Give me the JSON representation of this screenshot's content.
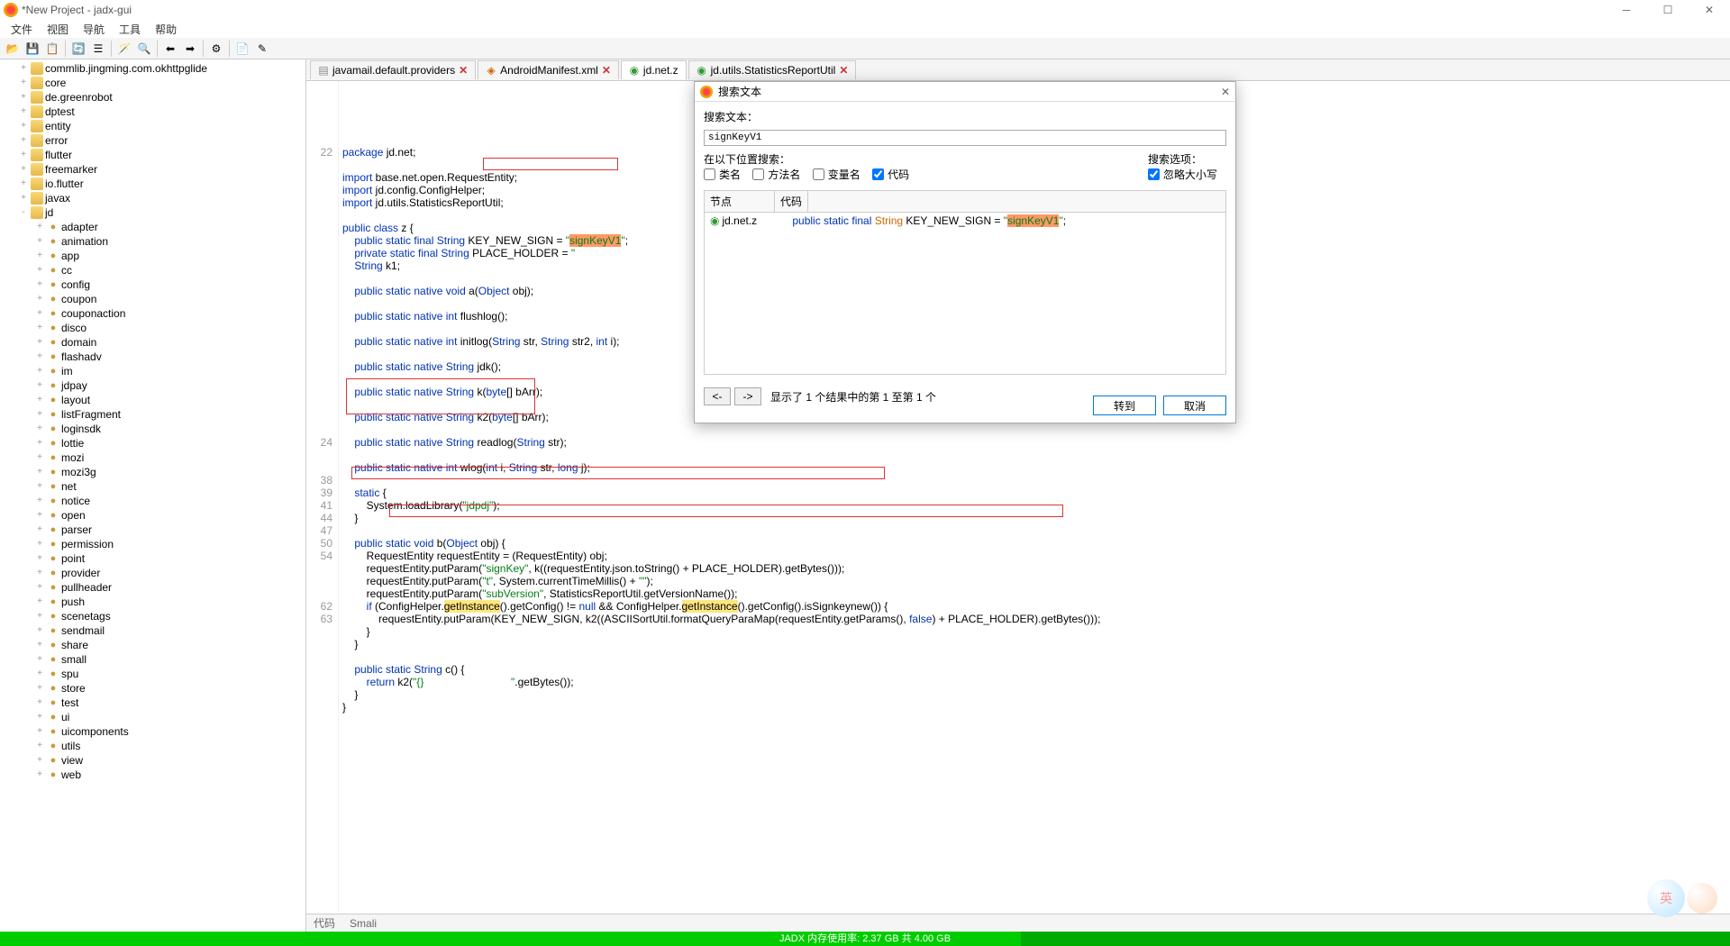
{
  "window": {
    "title": "*New Project - jadx-gui"
  },
  "menu": [
    "文件",
    "视图",
    "导航",
    "工具",
    "帮助"
  ],
  "tree": [
    {
      "l": 0,
      "t": "+",
      "n": "commlib.jingming.com.okhttpglide",
      "ico": "folder"
    },
    {
      "l": 0,
      "t": "+",
      "n": "core",
      "ico": "folder"
    },
    {
      "l": 0,
      "t": "+",
      "n": "de.greenrobot",
      "ico": "folder"
    },
    {
      "l": 0,
      "t": "+",
      "n": "dptest",
      "ico": "folder"
    },
    {
      "l": 0,
      "t": "+",
      "n": "entity",
      "ico": "folder"
    },
    {
      "l": 0,
      "t": "+",
      "n": "error",
      "ico": "folder"
    },
    {
      "l": 0,
      "t": "+",
      "n": "flutter",
      "ico": "folder"
    },
    {
      "l": 0,
      "t": "+",
      "n": "freemarker",
      "ico": "folder"
    },
    {
      "l": 0,
      "t": "+",
      "n": "io.flutter",
      "ico": "folder"
    },
    {
      "l": 0,
      "t": "+",
      "n": "javax",
      "ico": "folder"
    },
    {
      "l": 0,
      "t": "-",
      "n": "jd",
      "ico": "folder"
    },
    {
      "l": 1,
      "t": "+",
      "n": "adapter",
      "ico": "pkg"
    },
    {
      "l": 1,
      "t": "+",
      "n": "animation",
      "ico": "pkg"
    },
    {
      "l": 1,
      "t": "+",
      "n": "app",
      "ico": "pkg"
    },
    {
      "l": 1,
      "t": "+",
      "n": "cc",
      "ico": "pkg"
    },
    {
      "l": 1,
      "t": "+",
      "n": "config",
      "ico": "pkg"
    },
    {
      "l": 1,
      "t": "+",
      "n": "coupon",
      "ico": "pkg"
    },
    {
      "l": 1,
      "t": "+",
      "n": "couponaction",
      "ico": "pkg"
    },
    {
      "l": 1,
      "t": "+",
      "n": "disco",
      "ico": "pkg"
    },
    {
      "l": 1,
      "t": "+",
      "n": "domain",
      "ico": "pkg"
    },
    {
      "l": 1,
      "t": "+",
      "n": "flashadv",
      "ico": "pkg"
    },
    {
      "l": 1,
      "t": "+",
      "n": "im",
      "ico": "pkg"
    },
    {
      "l": 1,
      "t": "+",
      "n": "jdpay",
      "ico": "pkg"
    },
    {
      "l": 1,
      "t": "+",
      "n": "layout",
      "ico": "pkg"
    },
    {
      "l": 1,
      "t": "+",
      "n": "listFragment",
      "ico": "pkg"
    },
    {
      "l": 1,
      "t": "+",
      "n": "loginsdk",
      "ico": "pkg"
    },
    {
      "l": 1,
      "t": "+",
      "n": "lottie",
      "ico": "pkg"
    },
    {
      "l": 1,
      "t": "+",
      "n": "mozi",
      "ico": "pkg"
    },
    {
      "l": 1,
      "t": "+",
      "n": "mozi3g",
      "ico": "pkg"
    },
    {
      "l": 1,
      "t": "+",
      "n": "net",
      "ico": "pkg"
    },
    {
      "l": 1,
      "t": "+",
      "n": "notice",
      "ico": "pkg"
    },
    {
      "l": 1,
      "t": "+",
      "n": "open",
      "ico": "pkg"
    },
    {
      "l": 1,
      "t": "+",
      "n": "parser",
      "ico": "pkg"
    },
    {
      "l": 1,
      "t": "+",
      "n": "permission",
      "ico": "pkg"
    },
    {
      "l": 1,
      "t": "+",
      "n": "point",
      "ico": "pkg"
    },
    {
      "l": 1,
      "t": "+",
      "n": "provider",
      "ico": "pkg"
    },
    {
      "l": 1,
      "t": "+",
      "n": "pullheader",
      "ico": "pkg"
    },
    {
      "l": 1,
      "t": "+",
      "n": "push",
      "ico": "pkg"
    },
    {
      "l": 1,
      "t": "+",
      "n": "scenetags",
      "ico": "pkg"
    },
    {
      "l": 1,
      "t": "+",
      "n": "sendmail",
      "ico": "pkg"
    },
    {
      "l": 1,
      "t": "+",
      "n": "share",
      "ico": "pkg"
    },
    {
      "l": 1,
      "t": "+",
      "n": "small",
      "ico": "pkg"
    },
    {
      "l": 1,
      "t": "+",
      "n": "spu",
      "ico": "pkg"
    },
    {
      "l": 1,
      "t": "+",
      "n": "store",
      "ico": "pkg"
    },
    {
      "l": 1,
      "t": "+",
      "n": "test",
      "ico": "pkg"
    },
    {
      "l": 1,
      "t": "+",
      "n": "ui",
      "ico": "pkg"
    },
    {
      "l": 1,
      "t": "+",
      "n": "uicomponents",
      "ico": "pkg"
    },
    {
      "l": 1,
      "t": "+",
      "n": "utils",
      "ico": "pkg"
    },
    {
      "l": 1,
      "t": "+",
      "n": "view",
      "ico": "pkg"
    },
    {
      "l": 1,
      "t": "+",
      "n": "web",
      "ico": "pkg"
    }
  ],
  "tabs": [
    {
      "label": "javamail.default.providers",
      "icon": "file",
      "active": false,
      "close": true
    },
    {
      "label": "AndroidManifest.xml",
      "icon": "xml",
      "active": false,
      "close": true
    },
    {
      "label": "jd.net.z",
      "icon": "class",
      "active": true,
      "close": false
    },
    {
      "label": "jd.utils.StatisticsReportUtil",
      "icon": "class",
      "active": false,
      "close": true
    }
  ],
  "gutter": [
    "",
    "",
    "",
    "",
    "",
    "22",
    "",
    "",
    "",
    "",
    "",
    "",
    "",
    "",
    "",
    "",
    "",
    "",
    "",
    "",
    "",
    "",
    "",
    "",
    "",
    "",
    "",
    "",
    "24",
    "",
    "",
    "38",
    "39",
    "41",
    "44",
    "47",
    "50",
    "54",
    "",
    "",
    "",
    "62",
    "63",
    "",
    "",
    ""
  ],
  "bottom": {
    "tab1": "代码",
    "tab2": "Smali"
  },
  "status": {
    "pct": 59,
    "text": "JADX 内存使用率: 2.37 GB 共 4.00 GB"
  },
  "dialog": {
    "title": "搜索文本",
    "label_search": "搜索文本：",
    "input": "signKeyV1",
    "label_where": "在以下位置搜索：",
    "label_opts": "搜索选项：",
    "chk_class": "类名",
    "chk_method": "方法名",
    "chk_var": "变量名",
    "chk_code": "代码",
    "chk_ignore": "忽略大小写",
    "col_node": "节点",
    "col_code": "代码",
    "result_node": "jd.net.z",
    "result_count": "显示了 1 个结果中的第 1 至第 1 个",
    "btn_goto": "转到",
    "btn_cancel": "取消"
  }
}
